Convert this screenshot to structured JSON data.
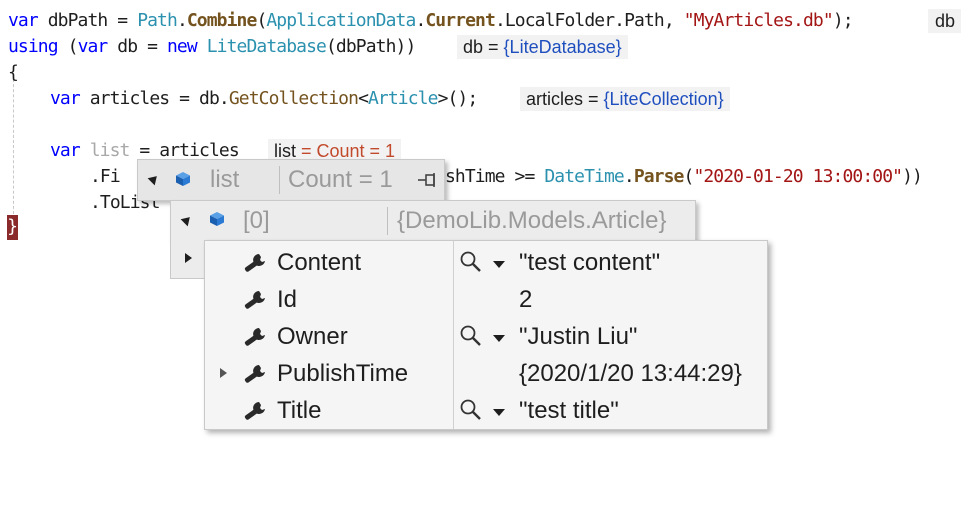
{
  "code": {
    "line1": {
      "k1": "var",
      "sp1": " dbPath = ",
      "t1": "Path",
      "d1": ".",
      "m1": "Combine",
      "o1": "(",
      "t2": "ApplicationData",
      "d2": ".",
      "m2": "Current",
      "r1": ".LocalFolder.Path, ",
      "s1": "\"MyArticles.db\"",
      "r2": ");"
    },
    "line2": {
      "k1": "using",
      "r1": " (",
      "k2": "var",
      "r2": " db = ",
      "k3": "new",
      "r3": " ",
      "t1": "LiteDatabase",
      "r4": "(dbPath))"
    },
    "line3": {
      "r1": "{"
    },
    "line4": {
      "k1": "var",
      "r1": " articles = db.",
      "m1": "GetCollection",
      "r2": "<",
      "t1": "Article",
      "r3": ">();"
    },
    "line5": {
      "k1": "var",
      "r1": " ",
      "d1": "list",
      "r2": " = articles"
    },
    "line6": {
      "r1": ".Fi",
      "r2": "shTime >= ",
      "t1": "DateTime",
      "r3": ".",
      "m1": "Parse",
      "r4": "(",
      "s1": "\"2020-01-20 13:00:00\"",
      "r5": "))"
    },
    "line7": {
      "r1": ".ToList"
    },
    "line8": {
      "r1": "}"
    }
  },
  "inline_hints": {
    "db_trunc": "db",
    "db_name": "db",
    "db_value": "{LiteDatabase}",
    "articles_name": "articles",
    "articles_value": "{LiteCollection}",
    "list_name": "list",
    "list_eq": " = ",
    "list_count": "Count = 1"
  },
  "datatip": {
    "root": {
      "name": "list",
      "value": "Count = 1"
    },
    "item": {
      "name": "[0]",
      "value": "{DemoLib.Models.Article}"
    },
    "properties": [
      {
        "name": "Content",
        "value": "\"test content\"",
        "inspectable": true,
        "expandable": false
      },
      {
        "name": "Id",
        "value": "2",
        "inspectable": false,
        "expandable": false
      },
      {
        "name": "Owner",
        "value": "\"Justin Liu\"",
        "inspectable": true,
        "expandable": false
      },
      {
        "name": "PublishTime",
        "value": "{2020/1/20 13:44:29}",
        "inspectable": false,
        "expandable": true
      },
      {
        "name": "Title",
        "value": "\"test title\"",
        "inspectable": true,
        "expandable": false
      }
    ]
  },
  "icons": {
    "object": "object-cube-icon",
    "property": "wrench-icon",
    "inspect": "magnifier-icon",
    "dropdown": "chevron-down-icon",
    "pin": "pin-icon"
  },
  "colors": {
    "keyword": "#0000ff",
    "type": "#2b91af",
    "string": "#a31515",
    "method": "#74531f",
    "value": "#1f4fbf"
  }
}
